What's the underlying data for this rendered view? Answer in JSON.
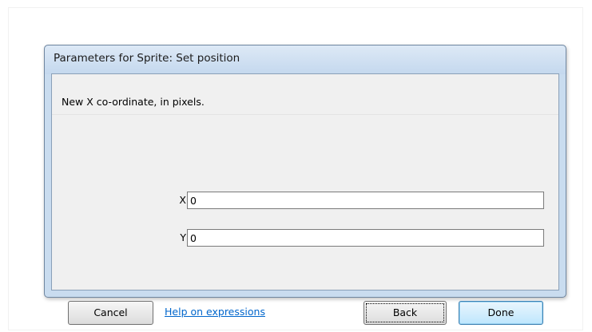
{
  "dialog": {
    "title": "Parameters for Sprite: Set position",
    "description": "New X co-ordinate, in pixels.",
    "fields": [
      {
        "label": "X",
        "value": "0"
      },
      {
        "label": "Y",
        "value": "0"
      }
    ],
    "buttons": {
      "cancel": "Cancel",
      "help_link": "Help on expressions",
      "back": "Back",
      "done": "Done"
    }
  }
}
